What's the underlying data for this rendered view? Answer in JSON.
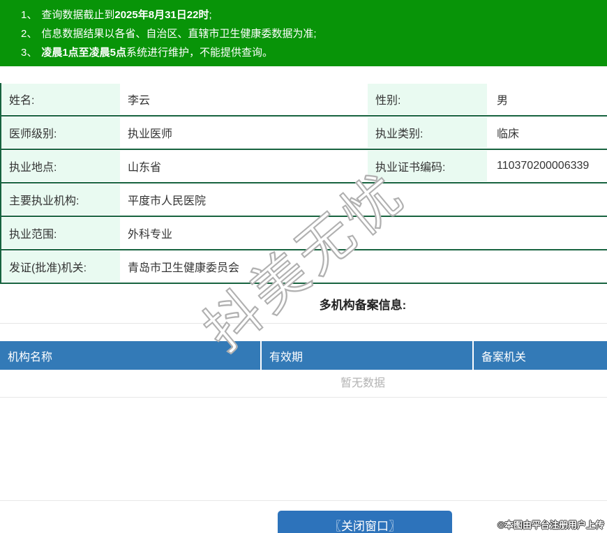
{
  "notice": {
    "line1_num": "1、",
    "line1_text": "查询数据截止到",
    "line1_bold": "2025年8月31日22时",
    "line1_tail": ";",
    "line2_num": "2、",
    "line2_text": "信息数据结果以各省、自治区、直辖市卫生健康委数据为准;",
    "line3_num": "3、",
    "line3_bold": "凌晨1点至凌晨5点",
    "line3_tail": "系统进行维护，不能提供查询。"
  },
  "info": {
    "rows": [
      {
        "label1": "姓名:",
        "value1": "李云",
        "label2": "性别:",
        "value2": "男"
      },
      {
        "label1": "医师级别:",
        "value1": "执业医师",
        "label2": "执业类别:",
        "value2": "临床"
      },
      {
        "label1": "执业地点:",
        "value1": "山东省",
        "label2": "执业证书编码:",
        "value2": "110370200006339"
      },
      {
        "label": "主要执业机构:",
        "value": "平度市人民医院"
      },
      {
        "label": "执业范围:",
        "value": "外科专业"
      },
      {
        "label": "发证(批准)机关:",
        "value": "青岛市卫生健康委员会"
      }
    ]
  },
  "section": {
    "title": "多机构备案信息:"
  },
  "org_table": {
    "headers": [
      "机构名称",
      "有效期",
      "备案机关"
    ],
    "empty_text": "暂无数据"
  },
  "footer": {
    "close_button_label": "〖关闭窗口〗",
    "copyright": "©本图由平台注册用户上传"
  },
  "watermark": {
    "text": "抖美无忧"
  },
  "colors": {
    "banner_green": "#089408",
    "divider_green": "#17633f",
    "label_cell_bg": "#e9faf1",
    "table_header_blue": "#337ab7",
    "button_blue": "#2d73bb",
    "empty_text_gray": "#b3b3b3",
    "notice_text": "#ffffff"
  }
}
